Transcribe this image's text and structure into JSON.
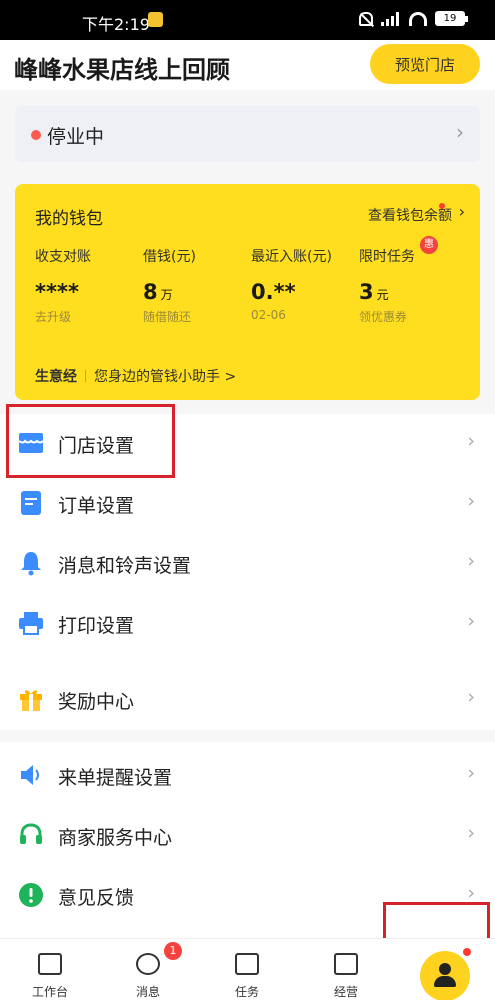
{
  "status_bar": {
    "time": "下午2:19",
    "network": "HD",
    "battery": "19"
  },
  "header": {
    "title": "峰峰水果店线上回顾",
    "preview_label": "预览门店"
  },
  "store_status": {
    "label": "停业中",
    "dot_color": "#ff5a4f"
  },
  "wallet": {
    "title": "我的钱包",
    "balance_link": "查看钱包余额",
    "stats": [
      {
        "label": "收支对账",
        "value": "****",
        "unit": "",
        "sub": "去升级"
      },
      {
        "label": "借钱(元)",
        "value": "8",
        "unit": "万",
        "sub": "随借随还"
      },
      {
        "label": "最近入账(元)",
        "value": "0.**",
        "unit": "",
        "sub": "02-06"
      },
      {
        "label": "限时任务",
        "value": "3",
        "unit": "元",
        "sub": "领优惠券",
        "badge": "惠"
      }
    ],
    "footer_title": "生意经",
    "footer_text": "您身边的管钱小助手 >",
    "background_color": "#ffde1f"
  },
  "menu": [
    {
      "label": "门店设置",
      "icon": "store-icon"
    },
    {
      "label": "订单设置",
      "icon": "order-icon"
    },
    {
      "label": "消息和铃声设置",
      "icon": "bell-icon"
    },
    {
      "label": "打印设置",
      "icon": "printer-icon"
    },
    {
      "label": "奖励中心",
      "icon": "gift-icon"
    },
    {
      "label": "来单提醒设置",
      "icon": "speaker-icon"
    },
    {
      "label": "商家服务中心",
      "icon": "headset-icon"
    },
    {
      "label": "意见反馈",
      "icon": "feedback-icon"
    }
  ],
  "bottom_nav": [
    {
      "label": "工作台",
      "icon": "workbench-icon"
    },
    {
      "label": "消息",
      "icon": "message-icon",
      "badge": "1"
    },
    {
      "label": "任务",
      "icon": "task-icon"
    },
    {
      "label": "经营",
      "icon": "chart-icon"
    },
    {
      "label": "",
      "icon": "profile-icon"
    }
  ],
  "colors": {
    "accent": "#ffd21f",
    "alert": "#f4433c",
    "highlight_box": "#d6222b"
  }
}
